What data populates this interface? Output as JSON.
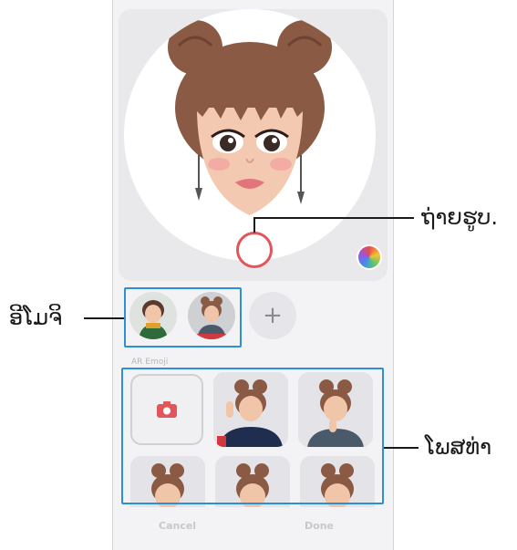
{
  "callouts": {
    "capture_label": "ຖ່າຍຮູບ.",
    "emoji_label": "ອີໂມຈິ",
    "pose_label": "ໂພສທ່າ"
  },
  "icons": {
    "capture": "capture-ring-icon",
    "palette": "color-palette-icon",
    "add": "plus-icon",
    "camera": "camera-icon"
  },
  "add_symbol": "+",
  "section": {
    "label": "AR Emoji"
  },
  "bottom_bar": {
    "cancel_label": "Cancel",
    "done_label": "Done"
  },
  "colors": {
    "capture_ring": "#e2555d",
    "highlight": "#2d8fd6",
    "camera_icon": "#e2555d"
  }
}
